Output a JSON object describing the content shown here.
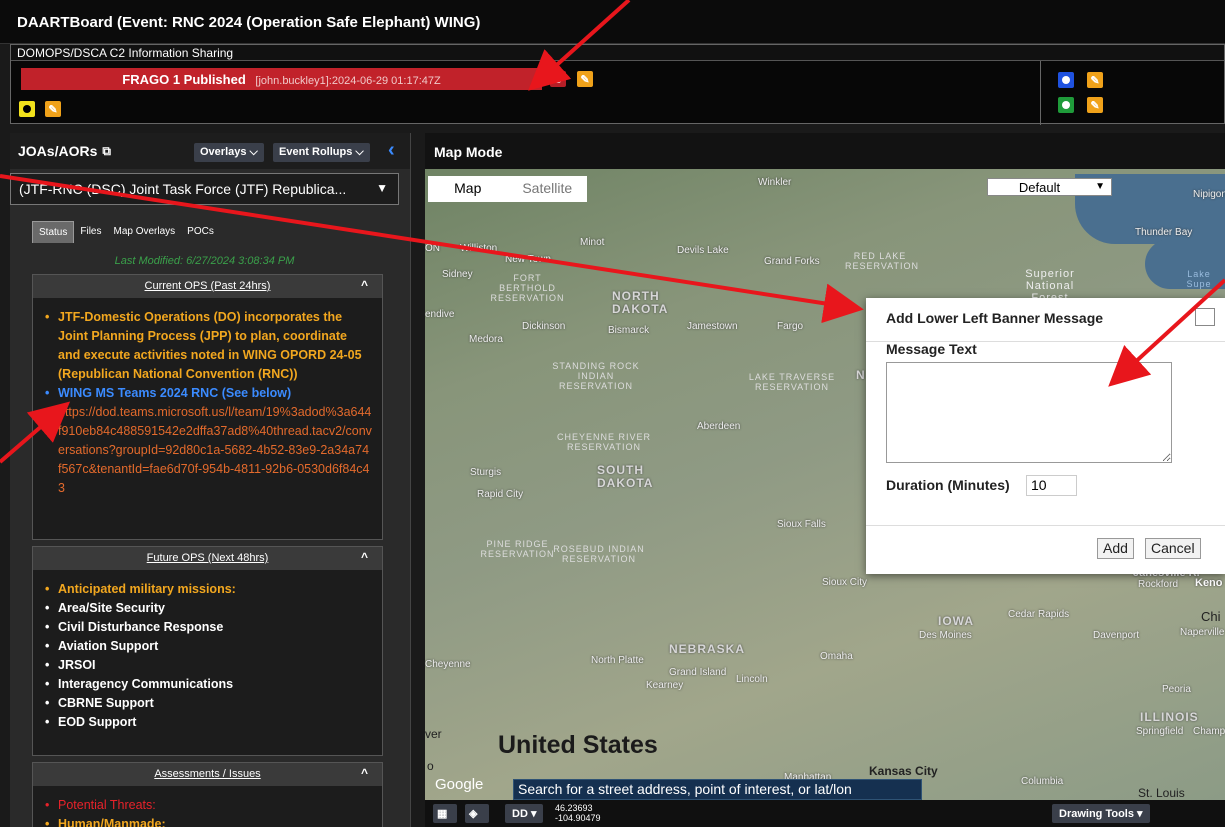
{
  "app": {
    "title": "DAARTBoard (Event: RNC 2024 (Operation Safe Elephant) WING)"
  },
  "banner": {
    "header": "DOMOPS/DSCA C2 Information Sharing",
    "frago_text": "FRAGO 1 Published",
    "frago_meta": "[john.buckley1]:2024-06-29 01:17:47Z"
  },
  "left_panel": {
    "title": "JOAs/AORs",
    "overlays_label": "Overlays",
    "rollups_label": "Event Rollups",
    "selected_task_force": "(JTF-RNC (DSC) Joint Task Force (JTF) Republica...",
    "tabs": [
      "Status",
      "Files",
      "Map Overlays",
      "POCs"
    ],
    "last_modified": "Last Modified: 6/27/2024 3:08:34 PM",
    "current_ops": {
      "header": "Current OPS (Past 24hrs)",
      "items": [
        "JTF-Domestic Operations (DO) incorporates the Joint Planning Process (JPP) to plan, coordinate and execute activities noted in WING OPORD 24-05 (Republican National Convention (RNC))",
        "WING MS Teams 2024 RNC (See below)",
        "https://dod.teams.microsoft.us/l/team/19%3adod%3a644f910eb84c488591542e2dffa37ad8%40thread.tacv2/conversations?groupId=92d80c1a-5682-4b52-83e9-2a34a74f567c&tenantId=fae6d70f-954b-4811-92b6-0530d6f84c43"
      ]
    },
    "future_ops": {
      "header": "Future OPS (Next 48hrs)",
      "items": [
        "Anticipated military missions:",
        "Area/Site Security",
        "Civil Disturbance Response",
        "Aviation Support",
        "JRSOI",
        "Interagency Communications",
        "CBRNE Support",
        "EOD Support"
      ]
    },
    "assessments": {
      "header": "Assessments / Issues",
      "items": [
        "Potential Threats:",
        "Human/Manmade:"
      ]
    }
  },
  "map": {
    "mode_title": "Map Mode",
    "map_tab": "Map",
    "satellite_tab": "Satellite",
    "style_select": "Default",
    "country_label": "United States",
    "google": "Google",
    "search_placeholder": "Search for a street address, point of interest, or lat/lon",
    "labels": {
      "winkler": "Winkler",
      "nipigon": "Nipigon",
      "thunder_bay": "Thunder Bay",
      "williston": "Williston",
      "minot": "Minot",
      "devils_lake": "Devils Lake",
      "new_town": "New Town",
      "grand_forks": "Grand Forks",
      "sidney": "Sidney",
      "bismarck": "Bismarck",
      "jamestown": "Jamestown",
      "fargo": "Fargo",
      "medora": "Medora",
      "aberdeen": "Aberdeen",
      "sturgis": "Sturgis",
      "rapid_city": "Rapid City",
      "sioux_falls": "Sioux Falls",
      "sioux_city": "Sioux City",
      "north_platte": "North Platte",
      "grand_island": "Grand Island",
      "kearney": "Kearney",
      "lincoln": "Lincoln",
      "omaha": "Omaha",
      "cheyenne": "Cheyenne",
      "des_moines": "Des Moines",
      "cedar_rapids": "Cedar Rapids",
      "davenport": "Davenport",
      "peoria": "Peoria",
      "naperville": "Naperville",
      "springfield": "Springfield",
      "champaign": "Champaig",
      "kansas_city": "Kansas City",
      "columbia": "Columbia",
      "st_louis": "St. Louis",
      "manhattan": "Manhattan",
      "rockford": "Rockford",
      "janesville": "Janesville R.",
      "chicago": "Chi",
      "kenosha": "Keno",
      "on": "ON",
      "dickinson": "Dickinson",
      "endive": "endive",
      "ver": "ver",
      "o": "o"
    },
    "states": {
      "nd": "NORTH DAKOTA",
      "sd": "SOUTH DAKOTA",
      "ne": "NEBRASKA",
      "ia": "IOWA",
      "il": "ILLINOIS",
      "n": "N"
    },
    "reservations": {
      "fort_berthold": "FORT BERTHOLD RESERVATION",
      "red_lake": "RED LAKE RESERVATION",
      "superior": "Superior National Forest",
      "standing_rock": "STANDING ROCK INDIAN RESERVATION",
      "lake_traverse": "LAKE TRAVERSE RESERVATION",
      "cheyenne_river": "CHEYENNE RIVER RESERVATION",
      "pine_ridge": "PINE RIDGE RESERVATION",
      "rosebud": "ROSEBUD INDIAN RESERVATION",
      "lake_sup": "Lake Supe"
    },
    "footer": {
      "dd_label": "DD",
      "lat": "46.23693",
      "lon": "-104.90479",
      "drawing_tools": "Drawing Tools"
    }
  },
  "dialog": {
    "title": "Add Lower Left Banner Message",
    "message_label": "Message Text",
    "message_value": "",
    "duration_label": "Duration (Minutes)",
    "duration_value": "10",
    "add_label": "Add",
    "cancel_label": "Cancel"
  },
  "colors": {
    "banner_red": "#c1222a",
    "accent_orange": "#f2a71f",
    "link_blue": "#3b8bff",
    "annotation_red": "#e8161c"
  }
}
